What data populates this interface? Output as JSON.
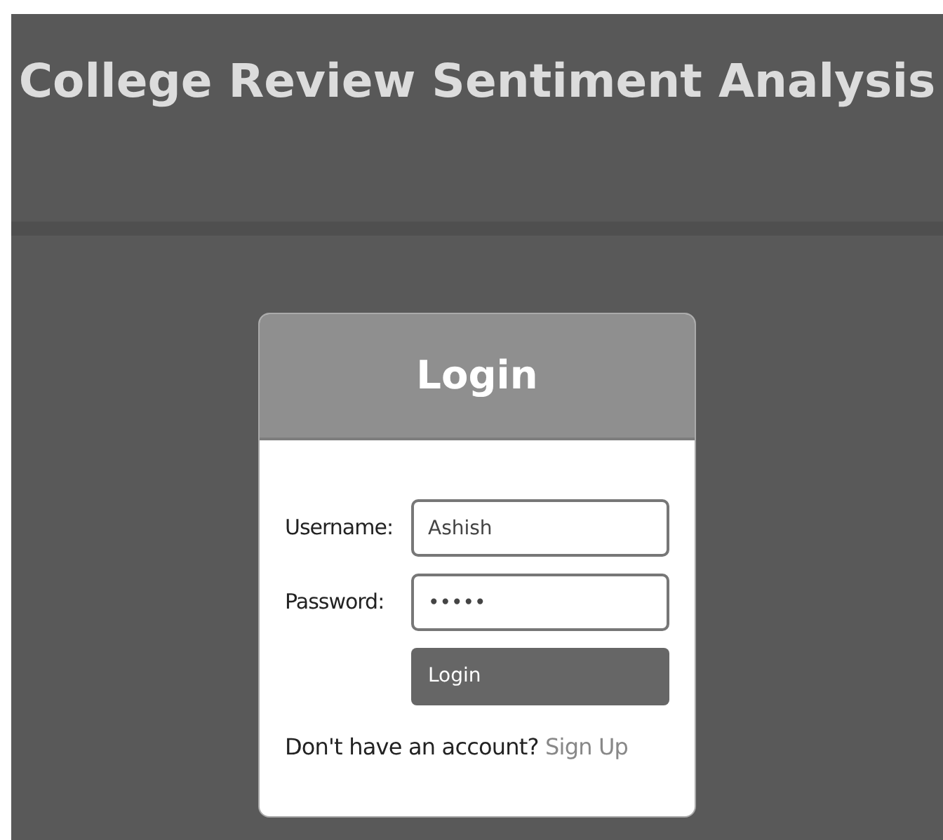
{
  "header": {
    "title": "College Review Sentiment Analysis"
  },
  "login_card": {
    "title": "Login",
    "fields": [
      {
        "label": "Username:",
        "value": "Ashish"
      },
      {
        "label": "Password:",
        "value": "•••••"
      }
    ],
    "button": "Login",
    "signup_prompt": "Don't have an account?",
    "signup_link": "Sign Up"
  }
}
